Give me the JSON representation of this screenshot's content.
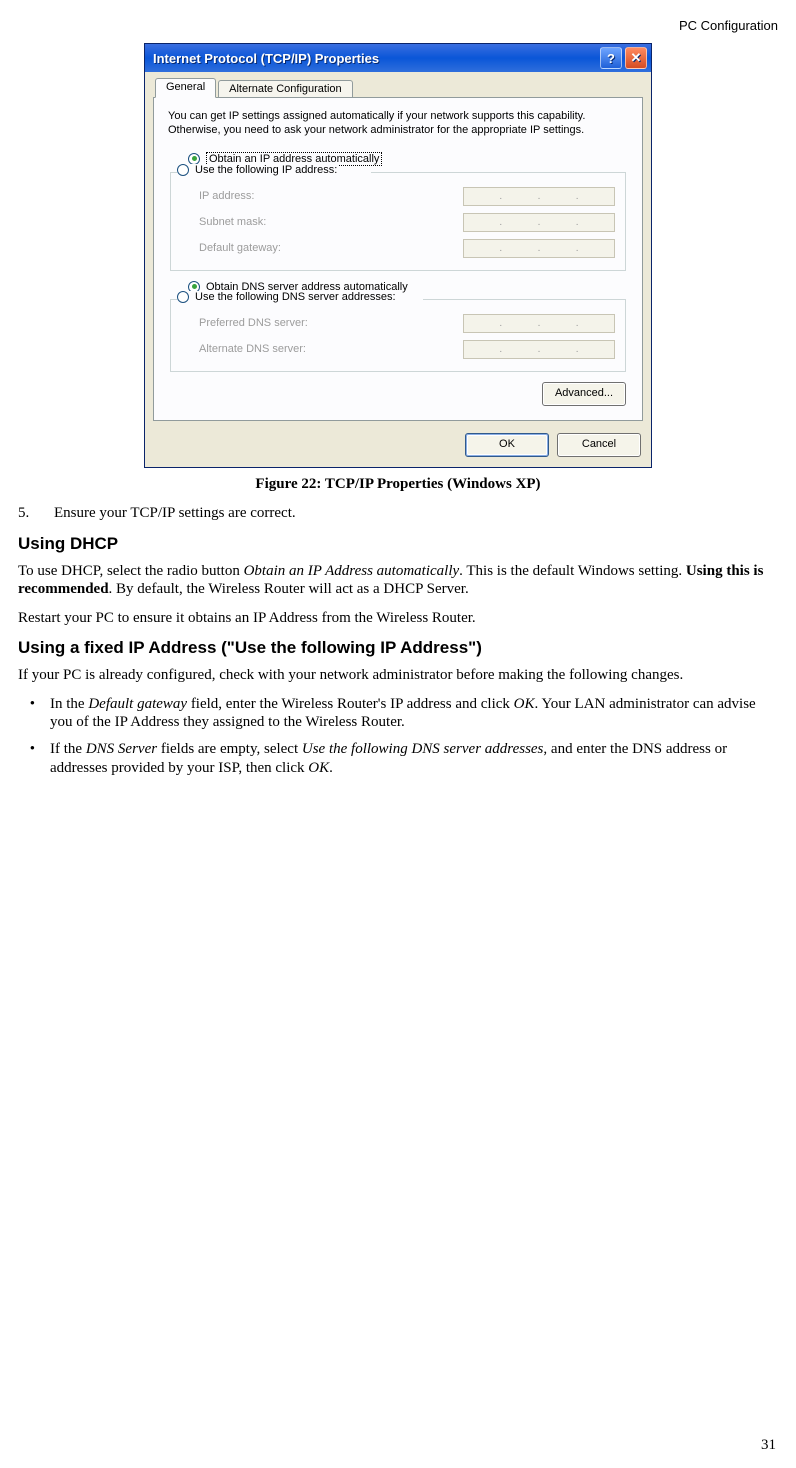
{
  "header": {
    "section": "PC Configuration"
  },
  "dialog": {
    "title": "Internet Protocol (TCP/IP) Properties",
    "help": "?",
    "close": "✕",
    "tabs": {
      "general": "General",
      "alt": "Alternate Configuration"
    },
    "description": "You can get IP settings assigned automatically if your network supports this capability. Otherwise, you need to ask your network administrator for the appropriate IP settings.",
    "radio_auto_ip": "Obtain an IP address automatically",
    "radio_fixed_ip": "Use the following IP address:",
    "radio_auto_dns": "Obtain DNS server address automatically",
    "radio_fixed_dns": "Use the following DNS server addresses:",
    "fields": {
      "ip": "IP address:",
      "subnet": "Subnet mask:",
      "gateway": "Default gateway:",
      "pref_dns": "Preferred DNS server:",
      "alt_dns": "Alternate DNS server:"
    },
    "buttons": {
      "advanced": "Advanced...",
      "ok": "OK",
      "cancel": "Cancel"
    }
  },
  "caption": "Figure 22: TCP/IP Properties (Windows XP)",
  "step5": {
    "num": "5.",
    "text": "Ensure your TCP/IP settings are correct."
  },
  "h_dhcp": "Using DHCP",
  "p_dhcp_1a": "To use DHCP, select the radio button ",
  "p_dhcp_1b": "Obtain an IP Address automatically",
  "p_dhcp_1c": ". This is the default Windows setting. ",
  "p_dhcp_1d": "Using this is recommended",
  "p_dhcp_1e": ". By default, the Wireless Router will act as a DHCP Server.",
  "p_dhcp_2": "Restart your PC to ensure it obtains an IP Address from the Wireless Router.",
  "h_fixed": "Using a fixed IP Address (\"Use the following IP Address\")",
  "p_fixed": "If your PC is already configured, check with your network administrator before making the following changes.",
  "bullet1": {
    "a": "In the ",
    "b": "Default gateway",
    "c": " field, enter the Wireless Router's IP address and click ",
    "d": "OK",
    "e": ". Your LAN administrator can advise you of the IP Address they assigned to the Wireless Router."
  },
  "bullet2": {
    "a": "If the ",
    "b": "DNS Server",
    "c": " fields are empty, select ",
    "d": "Use the following DNS server addresses",
    "e": ", and enter the DNS address or addresses provided by your ISP, then click ",
    "f": "OK",
    "g": "."
  },
  "page_number": "31"
}
